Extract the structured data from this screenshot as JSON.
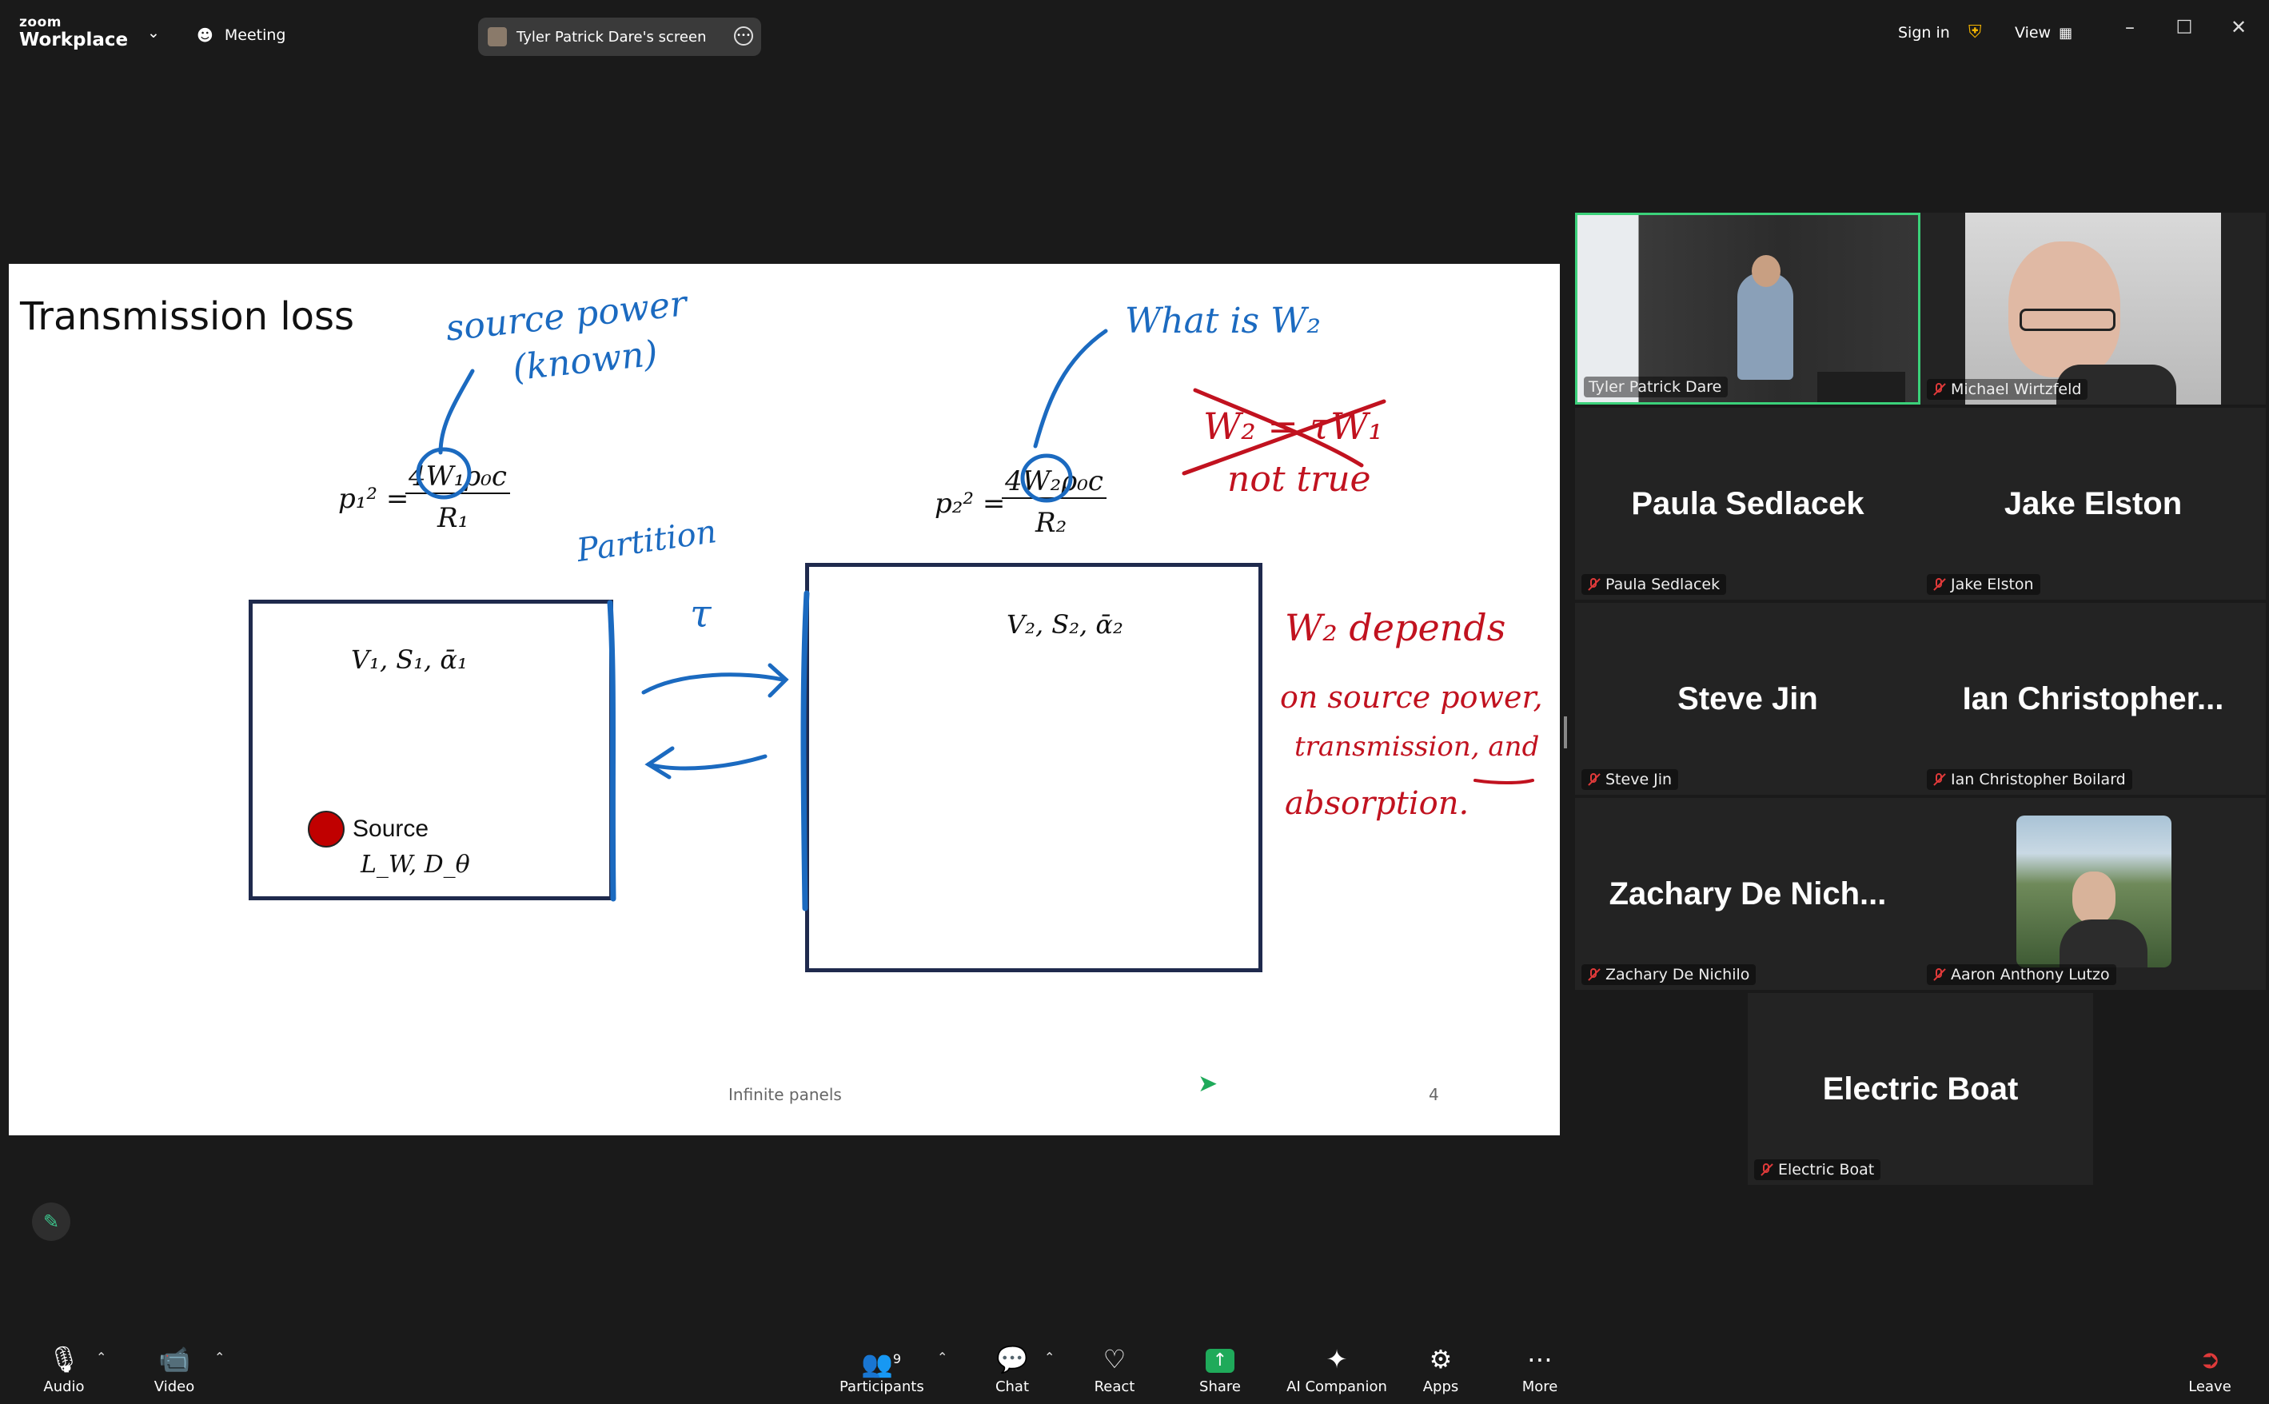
{
  "topbar": {
    "logo_line1": "zoom",
    "logo_line2": "Workplace",
    "meeting_label": "Meeting",
    "screen_share_label": "Tyler Patrick Dare's screen",
    "signin_label": "Sign in",
    "view_label": "View"
  },
  "slide": {
    "title": "Transmission loss",
    "footer": "Infinite panels",
    "page_number": "4",
    "eq1_lhs": "p₁² =",
    "eq1_num": "4W₁ρ₀c",
    "eq1_den": "R₁",
    "eq2_lhs": "p₂² =",
    "eq2_num": "4W₂ρ₀c",
    "eq2_den": "R₂",
    "room1_label": "V₁, S₁, ᾱ₁",
    "room2_label": "V₂, S₂, ᾱ₂",
    "source_label": "Source",
    "source_params": "L_W, D_θ",
    "annotations": {
      "source_power": "source power",
      "known": "(known)",
      "what_is": "What is W₂",
      "partition": "Partition",
      "tau": "τ",
      "crossed_eq": "W₂ = τW₁",
      "not_true": "not true",
      "depends_1": "W₂ depends",
      "depends_2": "on source power,",
      "depends_3": "transmission, and",
      "depends_4": "absorption."
    }
  },
  "participants": [
    {
      "name": "Tyler Patrick Dare",
      "display": "",
      "video": true,
      "muted": false,
      "active": true
    },
    {
      "name": "Michael Wirtzfeld",
      "display": "",
      "video": true,
      "muted": true,
      "active": false
    },
    {
      "name": "Paula Sedlacek",
      "display": "Paula Sedlacek",
      "video": false,
      "muted": true
    },
    {
      "name": "Jake Elston",
      "display": "Jake Elston",
      "video": false,
      "muted": true
    },
    {
      "name": "Steve Jin",
      "display": "Steve Jin",
      "video": false,
      "muted": true
    },
    {
      "name": "Ian Christopher Boilard",
      "display": "Ian Christopher...",
      "video": false,
      "muted": true
    },
    {
      "name": "Zachary De Nichilo",
      "display": "Zachary De Nich...",
      "video": false,
      "muted": true
    },
    {
      "name": "Aaron Anthony Lutzo",
      "display": "",
      "video": "avatar",
      "muted": true
    },
    {
      "name": "Electric Boat",
      "display": "Electric Boat",
      "video": false,
      "muted": true
    }
  ],
  "toolbar": {
    "audio": "Audio",
    "video": "Video",
    "participants": "Participants",
    "participants_count": "9",
    "chat": "Chat",
    "react": "React",
    "share": "Share",
    "ai_companion": "AI Companion",
    "apps": "Apps",
    "more": "More",
    "leave": "Leave"
  },
  "colors": {
    "background": "#1a1a1a",
    "tile": "#232323",
    "active_border": "#3bd17a",
    "annotation_blue": "#1b6ac0",
    "annotation_red": "#c1121f",
    "share_green": "#1faa5a",
    "mute_red": "#e03a3a"
  },
  "icons": [
    "chevron-down-icon",
    "meeting-icon",
    "more-icon",
    "shield-icon",
    "view-icon",
    "minimize-icon",
    "maximize-icon",
    "close-icon",
    "mic-muted-icon",
    "video-icon",
    "participants-icon",
    "chat-icon",
    "heart-icon",
    "share-icon",
    "sparkle-icon",
    "apps-icon",
    "more-icon",
    "leave-icon",
    "pencil-icon"
  ]
}
